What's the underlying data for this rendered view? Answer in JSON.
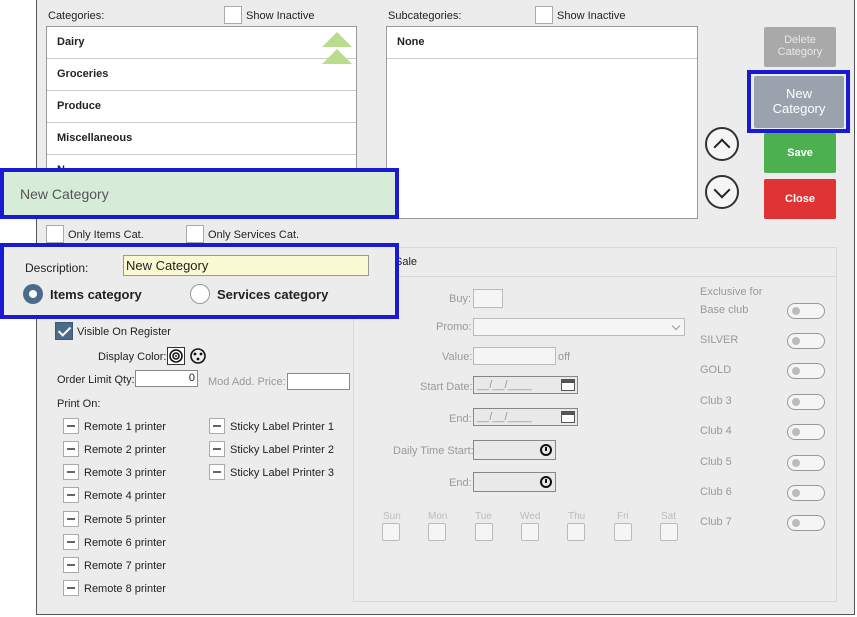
{
  "categories": {
    "label": "Categories:",
    "show_inactive": "Show Inactive",
    "items": [
      "Dairy",
      "Groceries",
      "Produce",
      "Miscellaneous",
      "N"
    ]
  },
  "subcategories": {
    "label": "Subcategories:",
    "show_inactive": "Show Inactive",
    "items": [
      "None"
    ]
  },
  "buttons": {
    "delete": "Delete Category",
    "new": "New Category",
    "save": "Save",
    "close": "Close"
  },
  "name_banner": "New Category",
  "filters": {
    "only_items": "Only Items Cat.",
    "only_services": "Only Services Cat."
  },
  "description": {
    "label": "Description:",
    "value": "New Category",
    "radio_items": "Items category",
    "radio_services": "Services category",
    "selected": "items"
  },
  "sale_header": "Sale",
  "visible_on_register": "Visible On Register",
  "display_color": "Display Color:",
  "order_limit": {
    "label": "Order Limit Qty:",
    "value": "0"
  },
  "mod_add_price": "Mod Add. Price:",
  "print_on": {
    "label": "Print On:",
    "remote": [
      "Remote 1 printer",
      "Remote 2 printer",
      "Remote 3 printer",
      "Remote 4 printer",
      "Remote 5 printer",
      "Remote 6 printer",
      "Remote 7 printer",
      "Remote 8 printer"
    ],
    "sticky": [
      "Sticky Label Printer 1",
      "Sticky Label Printer 2",
      "Sticky Label Printer 3"
    ]
  },
  "promo_fields": {
    "buy": "Buy:",
    "promo": "Promo:",
    "value": "Value:",
    "off": "off",
    "start_date": "Start Date:",
    "end_date": "End:",
    "date_placeholder": "__/__/____",
    "daily_time_start": "Daily Time Start:",
    "end_time": "End:"
  },
  "days": [
    "Sun",
    "Mon",
    "Tue",
    "Wed",
    "Thu",
    "Fri",
    "Sat"
  ],
  "clubs": {
    "exclusive_line1": "Exclusive for",
    "exclusive_line2": "Base club",
    "items": [
      "SILVER",
      "GOLD",
      "Club 3",
      "Club 4",
      "Club 5",
      "Club 6",
      "Club 7"
    ]
  },
  "colors": {
    "highlight": "#1a1ad4",
    "save": "#4caf50",
    "close": "#e03434",
    "new": "#9aa3ad",
    "delete": "#a9a9a9",
    "banner": "#d6ecd9",
    "description_input": "#fafad2"
  }
}
